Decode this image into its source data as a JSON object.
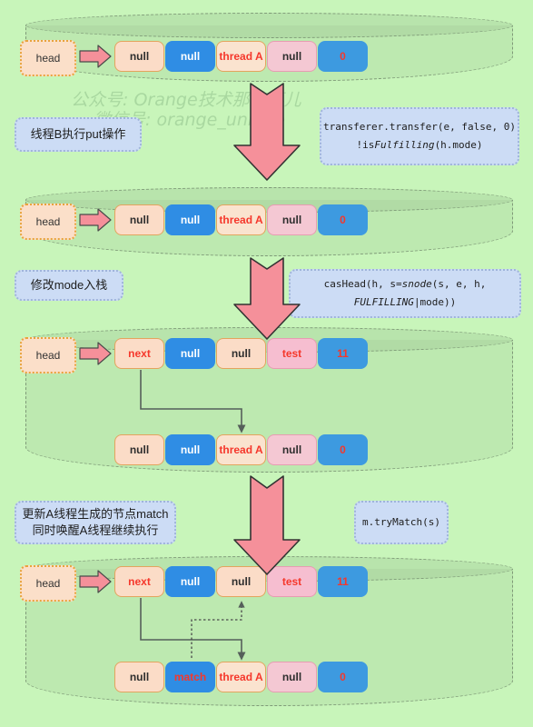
{
  "watermark": {
    "line1": "公众号: Orange技术那些事儿",
    "line2": "微信号: orange_unique"
  },
  "notes": [
    {
      "id": "note-put",
      "text": "线程B执行put操作"
    },
    {
      "id": "note-transfer-l1",
      "text": "transferer.transfer(e, false, 0)"
    },
    {
      "id": "note-transfer-l2a",
      "text": "!is"
    },
    {
      "id": "note-transfer-l2b",
      "text": "Fulfilling"
    },
    {
      "id": "note-transfer-l2c",
      "text": "(h.mode)"
    },
    {
      "id": "note-mode",
      "text": "修改mode入栈"
    },
    {
      "id": "note-cashead-a",
      "text": "casHead(h, s="
    },
    {
      "id": "note-cashead-b",
      "text": "snode"
    },
    {
      "id": "note-cashead-c",
      "text": "(s, e, h, "
    },
    {
      "id": "note-cashead-d",
      "text": "FULFILLING"
    },
    {
      "id": "note-cashead-e",
      "text": "|mode))"
    },
    {
      "id": "note-match-l1",
      "text": "更新A线程生成的节点match"
    },
    {
      "id": "note-match-l2",
      "text": "同时唤醒A线程继续执行"
    },
    {
      "id": "note-trymatch",
      "text": "m.tryMatch(s)"
    }
  ],
  "stacks": [
    {
      "id": "stack-1",
      "head_label": "head",
      "nodes": [
        {
          "id": "node-1-1",
          "cells": [
            "null",
            "null",
            "thread A",
            "null",
            "0"
          ]
        }
      ]
    },
    {
      "id": "stack-2",
      "head_label": "head",
      "nodes": [
        {
          "id": "node-2-1",
          "cells": [
            "null",
            "null",
            "thread A",
            "null",
            "0"
          ]
        }
      ]
    },
    {
      "id": "stack-3",
      "head_label": "head",
      "nodes": [
        {
          "id": "node-3-1",
          "cells": [
            "next",
            "null",
            "null",
            "test",
            "11"
          ]
        },
        {
          "id": "node-3-2",
          "cells": [
            "null",
            "null",
            "thread A",
            "null",
            "0"
          ]
        }
      ]
    },
    {
      "id": "stack-4",
      "head_label": "head",
      "nodes": [
        {
          "id": "node-4-1",
          "cells": [
            "next",
            "null",
            "null",
            "test",
            "11"
          ]
        },
        {
          "id": "node-4-2",
          "cells": [
            "null",
            "match",
            "thread A",
            "null",
            "0"
          ]
        }
      ]
    }
  ],
  "colors": {
    "background": "#c8f5ba",
    "cylinder_fill": "#96be8c",
    "cylinder_border": "#7f9a78",
    "arrow_fill": "#f5909a",
    "arrow_border": "#333333",
    "head_fill": "#fbdfc9",
    "head_border": "#e8a33d",
    "note_fill": "#ccdcf5",
    "note_border": "#9fb4da",
    "cell_peach": "#fbdcc7",
    "cell_blue": "#2f8de4",
    "cell_pink": "#f4c8d3",
    "red_text": "#f5372b",
    "watermark": "#a9d8a0"
  }
}
